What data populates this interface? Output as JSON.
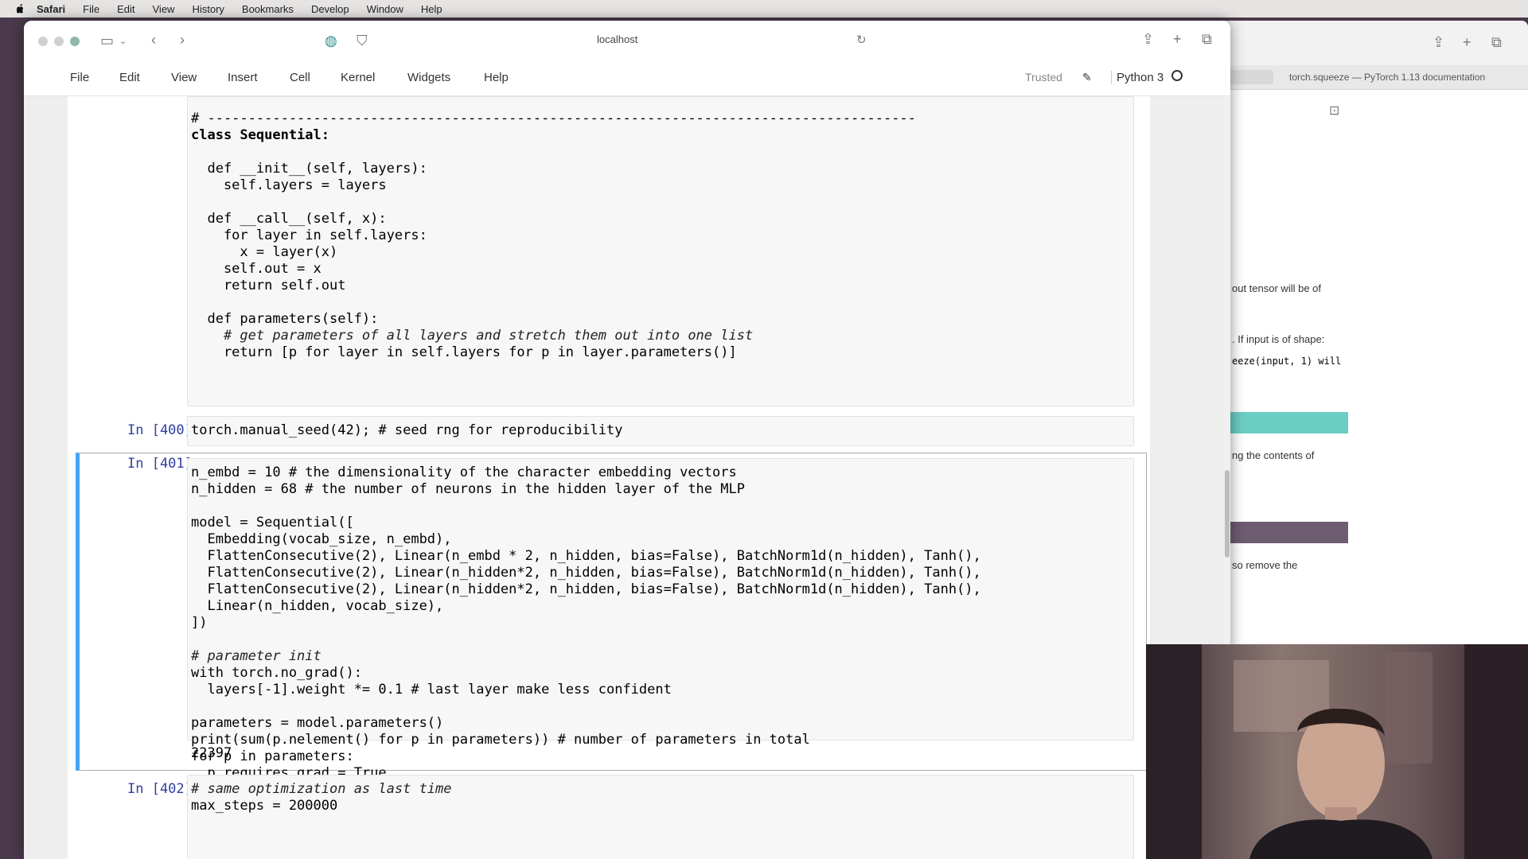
{
  "menubar": {
    "app": "Safari",
    "items": [
      "File",
      "Edit",
      "View",
      "History",
      "Bookmarks",
      "Develop",
      "Window",
      "Help"
    ]
  },
  "background_window": {
    "tab_title": "torch.squeeze — PyTorch 1.13 documentation",
    "texts": [
      {
        "text": "out tensor will be of"
      },
      {
        "text": ". If input is of shape:"
      },
      {
        "text": "eeze(input, 1) will"
      },
      {
        "text": "ng the contents of"
      },
      {
        "text": "so remove the"
      }
    ],
    "colors": {
      "teal": "#6ccdc5",
      "purple": "#6e5c70"
    }
  },
  "browser": {
    "address": "localhost"
  },
  "jupyter": {
    "menu": [
      "File",
      "Edit",
      "View",
      "Insert",
      "Cell",
      "Kernel",
      "Widgets",
      "Help"
    ],
    "trusted": "Trusted",
    "kernel": "Python 3"
  },
  "cells": {
    "cell_class": {
      "lines": [
        "# ---------------------------------------------------------------------------------------",
        "class Sequential:",
        "",
        "  def __init__(self, layers):",
        "    self.layers = layers",
        "",
        "  def __call__(self, x):",
        "    for layer in self.layers:",
        "      x = layer(x)",
        "    self.out = x",
        "    return self.out",
        "",
        "  def parameters(self):",
        "    # get parameters of all layers and stretch them out into one list",
        "    return [p for layer in self.layers for p in layer.parameters()]"
      ]
    },
    "cell_400": {
      "prompt": "In [400]:",
      "code": "torch.manual_seed(42); # seed rng for reproducibility"
    },
    "cell_401": {
      "prompt": "In [401]:",
      "lines": [
        "n_embd = 10 # the dimensionality of the character embedding vectors",
        "n_hidden = 68 # the number of neurons in the hidden layer of the MLP",
        "",
        "model = Sequential([",
        "  Embedding(vocab_size, n_embd),",
        "  FlattenConsecutive(2), Linear(n_embd * 2, n_hidden, bias=False), BatchNorm1d(n_hidden), Tanh(),",
        "  FlattenConsecutive(2), Linear(n_hidden*2, n_hidden, bias=False), BatchNorm1d(n_hidden), Tanh(),",
        "  FlattenConsecutive(2), Linear(n_hidden*2, n_hidden, bias=False), BatchNorm1d(n_hidden), Tanh(),",
        "  Linear(n_hidden, vocab_size),",
        "])",
        "",
        "# parameter init",
        "with torch.no_grad():",
        "  layers[-1].weight *= 0.1 # last layer make less confident",
        "",
        "parameters = model.parameters()",
        "print(sum(p.nelement() for p in parameters)) # number of parameters in total",
        "for p in parameters:",
        "  p.requires_grad = True"
      ],
      "output": "22397"
    },
    "cell_402": {
      "prompt": "In [402]:",
      "lines": [
        "# same optimization as last time",
        "max_steps = 200000"
      ]
    }
  },
  "colors": {
    "prompt": "#303f9f",
    "selected_cell_border": "#42a5f5"
  }
}
